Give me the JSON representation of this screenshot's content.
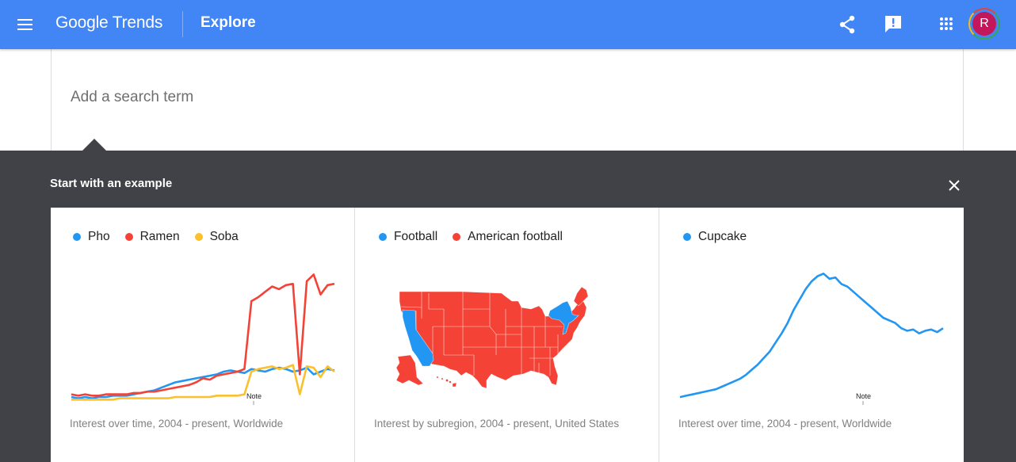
{
  "header": {
    "menu_icon": "hamburger-menu-icon",
    "logo": "Google Trends",
    "page_title": "Explore",
    "actions": [
      {
        "name": "share",
        "icon": "share-icon"
      },
      {
        "name": "feedback",
        "icon": "feedback-icon"
      },
      {
        "name": "apps",
        "icon": "apps-grid-icon"
      }
    ],
    "avatar_initial": "R",
    "avatar_color": "#c2185b"
  },
  "search": {
    "placeholder": "Add a search term",
    "value": ""
  },
  "examples": {
    "title": "Start with an example",
    "close_icon": "close-icon",
    "cards": [
      {
        "legend": [
          {
            "label": "Pho",
            "color": "#2196f3"
          },
          {
            "label": "Ramen",
            "color": "#f44336"
          },
          {
            "label": "Soba",
            "color": "#fbc02d"
          }
        ],
        "note_label": "Note",
        "caption": "Interest over time, 2004 - present, Worldwide"
      },
      {
        "legend": [
          {
            "label": "Football",
            "color": "#2196f3"
          },
          {
            "label": "American football",
            "color": "#f44336"
          }
        ],
        "caption": "Interest by subregion, 2004 - present, United States"
      },
      {
        "legend": [
          {
            "label": "Cupcake",
            "color": "#2196f3"
          }
        ],
        "note_label": "Note",
        "caption": "Interest over time, 2004 - present, Worldwide"
      }
    ]
  },
  "chart_data": [
    {
      "type": "line",
      "title": "",
      "xlabel": "",
      "ylabel": "",
      "x_range": [
        "2004",
        "present"
      ],
      "ylim": [
        0,
        100
      ],
      "grid": false,
      "legend": "top-left",
      "series": [
        {
          "name": "Pho",
          "color": "#2196f3",
          "values": [
            3,
            2,
            3,
            2,
            3,
            3,
            4,
            4,
            4,
            5,
            6,
            7,
            8,
            10,
            12,
            14,
            15,
            16,
            17,
            18,
            19,
            20,
            22,
            23,
            22,
            21,
            24,
            23,
            22,
            24,
            25,
            24,
            22,
            23,
            25,
            20,
            22,
            24,
            23
          ]
        },
        {
          "name": "Ramen",
          "color": "#f44336",
          "values": [
            5,
            4,
            5,
            4,
            4,
            5,
            5,
            5,
            5,
            6,
            6,
            7,
            7,
            8,
            9,
            10,
            11,
            12,
            14,
            17,
            16,
            19,
            20,
            21,
            22,
            24,
            75,
            78,
            82,
            86,
            84,
            87,
            88,
            20,
            90,
            95,
            80,
            87,
            88
          ]
        },
        {
          "name": "Soba",
          "color": "#fbc02d",
          "values": [
            1,
            1,
            1,
            1,
            1,
            1,
            1,
            2,
            2,
            2,
            2,
            2,
            2,
            2,
            2,
            3,
            3,
            3,
            3,
            3,
            3,
            4,
            4,
            4,
            4,
            5,
            22,
            24,
            25,
            26,
            24,
            25,
            27,
            5,
            26,
            25,
            18,
            26,
            22
          ]
        }
      ]
    },
    {
      "type": "map",
      "region": "United States",
      "legend": "top-left",
      "series": [
        {
          "name": "Football",
          "color": "#2196f3",
          "states": [
            "California",
            "New York",
            "New Jersey",
            "Vermont",
            "Massachusetts",
            "Connecticut",
            "Rhode Island"
          ]
        },
        {
          "name": "American football",
          "color": "#f44336",
          "states": [
            "all other states"
          ]
        }
      ]
    },
    {
      "type": "line",
      "xlabel": "",
      "ylabel": "",
      "x_range": [
        "2004",
        "present"
      ],
      "ylim": [
        0,
        100
      ],
      "grid": false,
      "legend": "top-left",
      "series": [
        {
          "name": "Cupcake",
          "color": "#2196f3",
          "values": [
            3,
            4,
            5,
            6,
            7,
            8,
            9,
            11,
            13,
            15,
            17,
            20,
            24,
            28,
            33,
            38,
            45,
            52,
            60,
            70,
            78,
            86,
            92,
            96,
            98,
            94,
            95,
            90,
            88,
            84,
            80,
            76,
            72,
            68,
            64,
            62,
            60,
            56,
            54,
            55,
            52,
            54,
            55,
            53,
            56
          ]
        }
      ]
    }
  ]
}
